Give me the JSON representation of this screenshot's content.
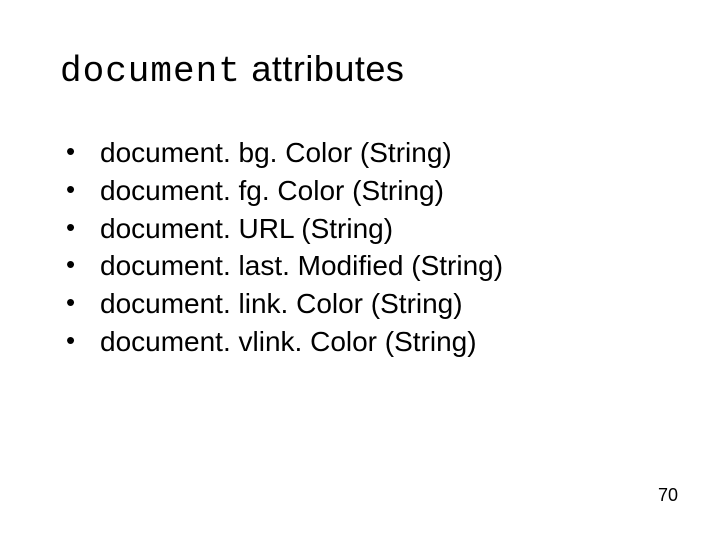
{
  "title": {
    "mono": "document",
    "rest": " attributes"
  },
  "items": [
    "document. bg. Color (String)",
    "document. fg. Color (String)",
    "document. URL (String)",
    "document. last. Modified (String)",
    "document. link. Color (String)",
    "document. vlink. Color (String)"
  ],
  "bullet": "•",
  "page": "70"
}
